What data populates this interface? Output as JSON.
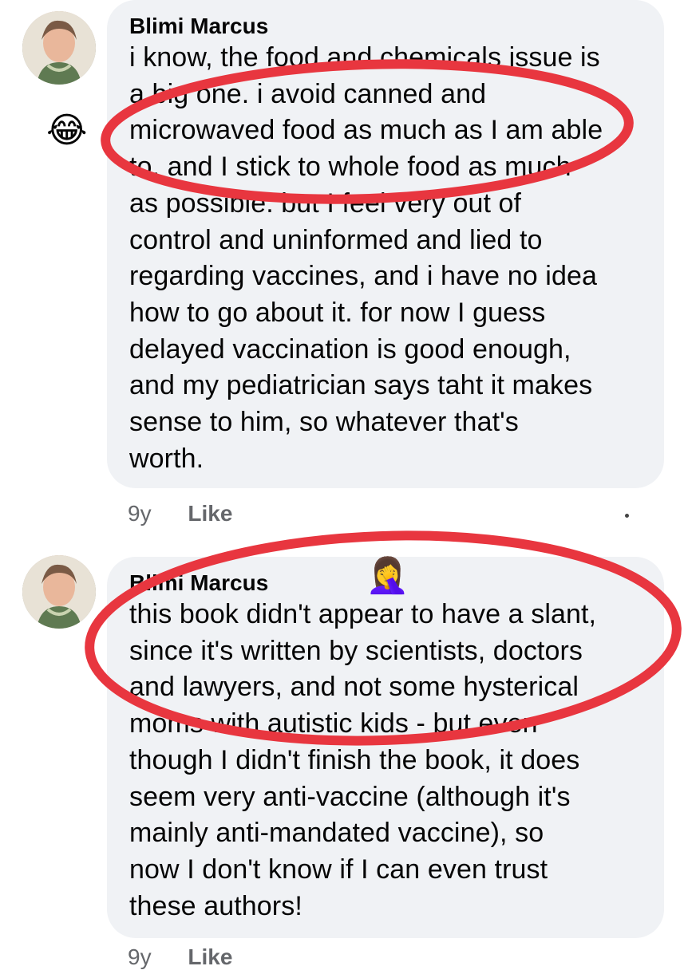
{
  "comments": [
    {
      "author": "Blimi Marcus",
      "lines": [
        "i know, the food and chemicals issue is",
        "a big one. i avoid canned and",
        "microwaved food as much as I am able",
        "to, and I stick to whole food as much",
        "as possible. but I feel very out of",
        "control and uninformed and lied to",
        "regarding vaccines, and i have no idea",
        "how to go about it. for now I guess",
        "delayed vaccination is good enough,",
        "and my pediatrician says taht it makes",
        "sense to him, so whatever that's",
        "worth."
      ],
      "time": "9y",
      "like_label": "Like",
      "reaction_emoji": "😂"
    },
    {
      "author": "Blimi Marcus",
      "lines": [
        "this book didn't appear to have a slant,",
        "since it's written by scientists, doctors",
        "and lawyers, and not some hysterical",
        "moms with autistic kids - but even",
        "though I didn't finish the book, it does",
        "seem very anti-vaccine  (although it's",
        "mainly anti-mandated vaccine), so",
        "now I don't know if I can even trust",
        "these authors!"
      ],
      "time": "9y",
      "like_label": "Like",
      "overlay_emoji": "🤦‍♀️"
    }
  ],
  "annotation_color": "#e8363f",
  "icons": {
    "avatar": "profile-photo",
    "more": "more-options-dot"
  }
}
